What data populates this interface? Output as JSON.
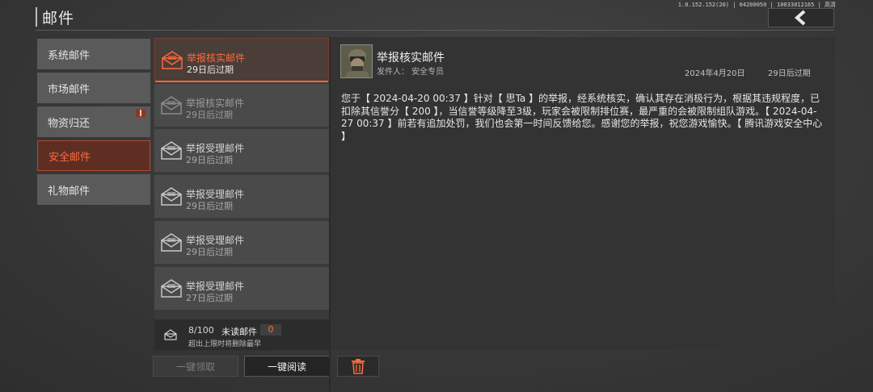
{
  "header": {
    "title": "邮件",
    "version": "1.0.152.152(20) | 04200050 | 10033012165 | 高清"
  },
  "tabs": [
    {
      "label": "系统邮件",
      "active": false
    },
    {
      "label": "市场邮件",
      "active": false
    },
    {
      "label": "物资归还",
      "active": false,
      "has_gift_badge": true
    },
    {
      "label": "安全邮件",
      "active": true
    },
    {
      "label": "礼物邮件",
      "active": false
    }
  ],
  "mails": [
    {
      "title": "举报核实邮件",
      "expiry": "29日后过期",
      "state": "selected"
    },
    {
      "title": "举报核实邮件",
      "expiry": "29日后过期",
      "state": "read"
    },
    {
      "title": "举报受理邮件",
      "expiry": "29日后过期",
      "state": "unread"
    },
    {
      "title": "举报受理邮件",
      "expiry": "29日后过期",
      "state": "unread"
    },
    {
      "title": "举报受理邮件",
      "expiry": "29日后过期",
      "state": "unread"
    },
    {
      "title": "举报受理邮件",
      "expiry": "27日后过期",
      "state": "unread"
    }
  ],
  "footer": {
    "count": "8/100",
    "unread_label": "未读邮件",
    "unread_count": "0",
    "note": "超出上限时将删除最早"
  },
  "buttons": {
    "collect_all": "一键领取",
    "read_all": "一键阅读",
    "delete_icon": "trash-icon"
  },
  "detail": {
    "title": "举报核实邮件",
    "sender_label": "发件人：",
    "sender": "安全专员",
    "date": "2024年4月20日",
    "expiry": "29日后过期",
    "content": "您于【 2024-04-20 00:37 】针对【 思Ta 】的举报，经系统核实，确认其存在消极行为，根据其违规程度，已扣除其信誉分【 200 】，当信誉等级降至3级，玩家会被限制排位赛，最严重的会被限制组队游戏。【 2024-04-27 00:37 】前若有追加处罚，我们也会第一时间反馈给您。感谢您的举报，祝您游戏愉快。【 腾讯游戏安全中心 】"
  },
  "colors": {
    "accent": "#ff6a3d",
    "active_tab_bg": "#5e2e22"
  }
}
